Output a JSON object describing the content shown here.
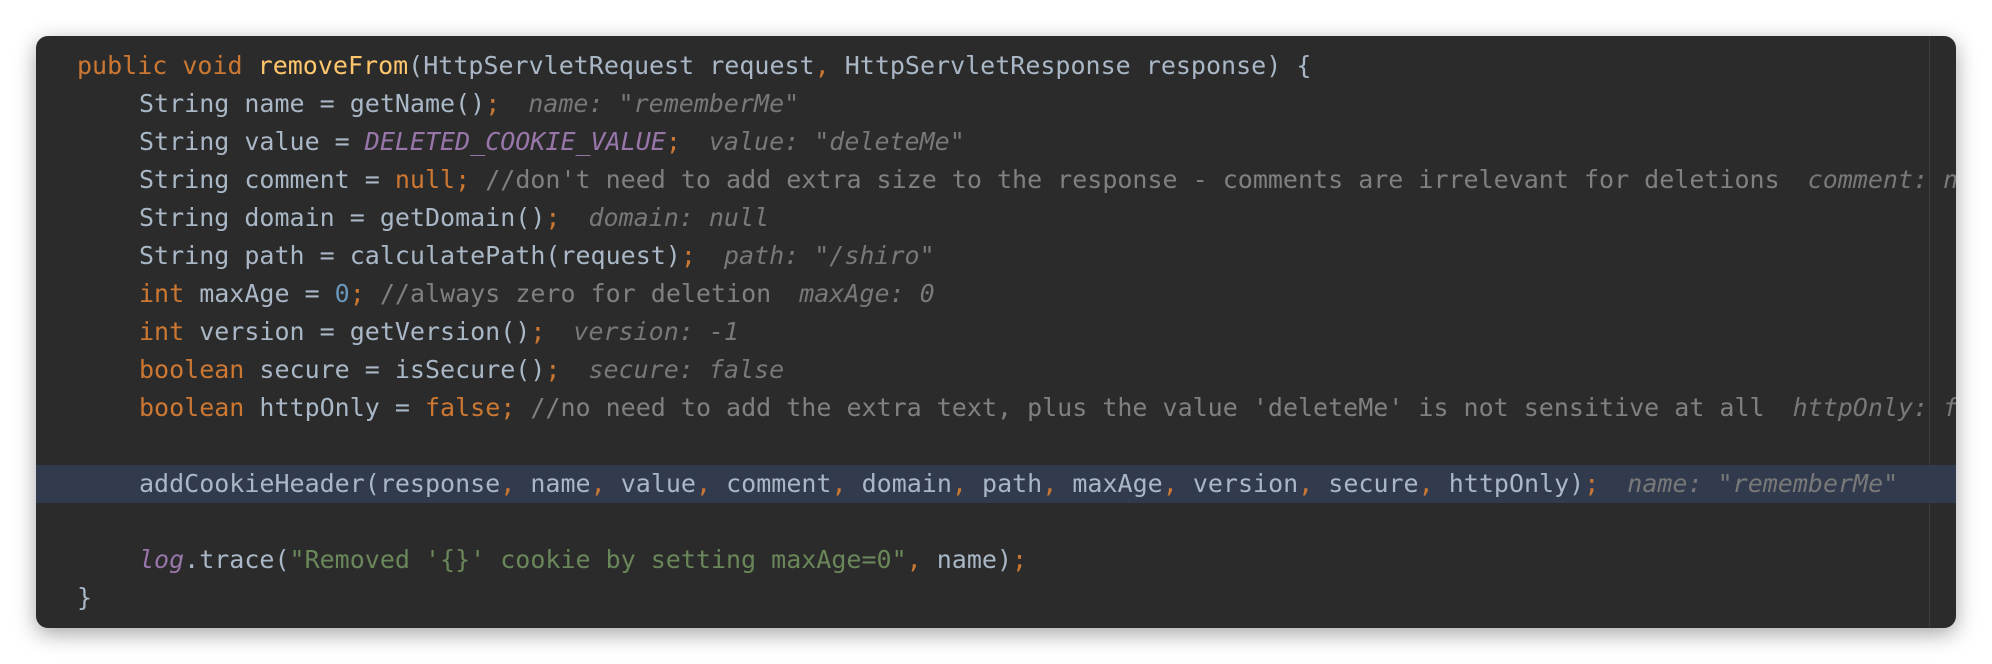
{
  "code": {
    "signature": {
      "kw_public": "public",
      "kw_void": "void",
      "method": "removeFrom",
      "open": "(",
      "p1_type": "HttpServletRequest",
      "p1_name": "request",
      "comma": ",",
      "p2_type": "HttpServletResponse",
      "p2_name": "response",
      "close": ")",
      "brace": "{"
    },
    "l_name": {
      "pre": "String name = getName()",
      "semi": ";",
      "hint": "name: \"rememberMe\""
    },
    "l_value": {
      "pre": "String value = ",
      "const": "DELETED_COOKIE_VALUE",
      "semi": ";",
      "hint": "value: \"deleteMe\""
    },
    "l_comment": {
      "pre": "String comment = ",
      "kw": "null",
      "semi": ";",
      "comment": "//don't need to add extra size to the response - comments are irrelevant for deletions",
      "hint": "comment: null"
    },
    "l_domain": {
      "pre": "String domain = getDomain()",
      "semi": ";",
      "hint": "domain: null"
    },
    "l_path": {
      "pre": "String path = calculatePath(request)",
      "semi": ";",
      "hint": "path: \"/shiro\""
    },
    "l_maxage": {
      "kw": "int",
      "pre": " maxAge = ",
      "num": "0",
      "semi": ";",
      "comment": "//always zero for deletion",
      "hint": "maxAge: 0"
    },
    "l_version": {
      "kw": "int",
      "pre": " version = getVersion()",
      "semi": ";",
      "hint": "version: -1"
    },
    "l_secure": {
      "kw": "boolean",
      "pre": " secure = isSecure()",
      "semi": ";",
      "hint": "secure: false"
    },
    "l_httponly": {
      "kw": "boolean",
      "pre": " httpOnly = ",
      "kw2": "false",
      "semi": ";",
      "comment": "//no need to add the extra text, plus the value 'deleteMe' is not sensitive at all",
      "hint": "httpOnly: false"
    },
    "l_add": {
      "call": "addCookieHeader(",
      "args": [
        "response",
        "name",
        "value",
        "comment",
        "domain",
        "path",
        "maxAge",
        "version",
        "secure",
        "httpOnly"
      ],
      "comma": ",",
      "close": ")",
      "semi": ";",
      "hint": "name: \"rememberMe\""
    },
    "l_log": {
      "var": "log",
      "call": ".trace(",
      "str": "\"Removed '{}' cookie by setting maxAge=0\"",
      "comma": ",",
      "arg": " name)",
      "semi": ";"
    },
    "closing_brace": "}"
  }
}
